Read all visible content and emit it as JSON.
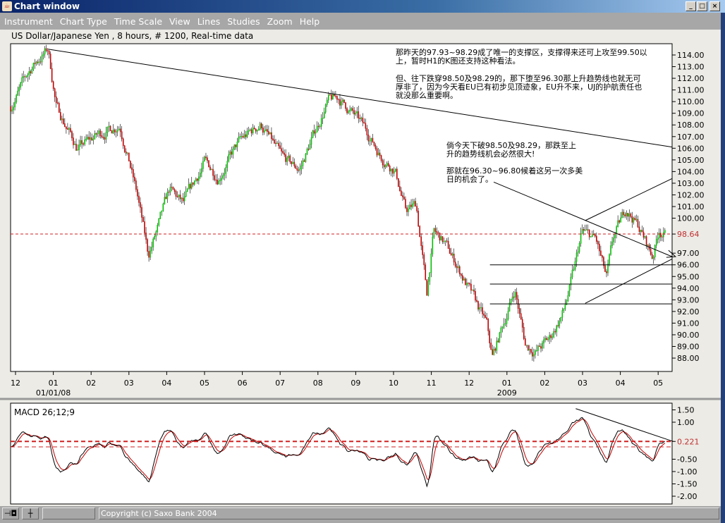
{
  "window": {
    "title": "Chart window",
    "controls": [
      "_",
      "□",
      "×"
    ]
  },
  "menu": [
    "Instrument",
    "Chart Type",
    "Time Scale",
    "View",
    "Lines",
    "Studies",
    "Zoom",
    "Help"
  ],
  "subtitle": "US Dollar/Japanese Yen , 8 hours, # 1200, Real-time data",
  "annotations": {
    "note1": "那昨天的97.93~98.29成了唯一的支撑区，支撑得来还可上攻至99.50以\n上，暂时H1的K图还支持这种看法。",
    "note2": "但、往下跌穿98.50及98.29的，那下堕至96.30那上升趋势线也就无可\n厚非了，因为今天看EU已有初步见顶迹象，EU升不来，UJ的护航责任也\n就没那么重要啊。",
    "note3": "倘今天下破98.50及98.29，那跌至上\n升的趋势线机会必然很大!",
    "note4": "那就在96.30~96.80候着这另一次多美\n日的机会了。"
  },
  "status": {
    "copyright": "Copyright (c) Saxo Bank 2004",
    "icons": [
      "pin-icon",
      "crosshair-icon"
    ]
  },
  "colors": {
    "up": "#00c000",
    "down": "#c00000",
    "ref": "#d02020",
    "text_red": "#c03030"
  },
  "chart_data": [
    {
      "type": "candlestick",
      "title": "US Dollar/Japanese Yen",
      "ylim": [
        87,
        115
      ],
      "yticks": [
        88,
        89,
        90,
        91,
        92,
        93,
        94,
        95,
        96,
        97,
        98.64,
        100,
        101,
        102,
        103,
        104,
        105,
        106,
        107,
        108,
        109,
        110,
        111,
        112,
        113,
        114
      ],
      "xticks": [
        {
          "label": "12",
          "t": 0
        },
        {
          "label": "01",
          "t": 1,
          "sub": "01/01/08"
        },
        {
          "label": "02",
          "t": 2
        },
        {
          "label": "03",
          "t": 3
        },
        {
          "label": "04",
          "t": 4
        },
        {
          "label": "05",
          "t": 5
        },
        {
          "label": "06",
          "t": 6
        },
        {
          "label": "07",
          "t": 7
        },
        {
          "label": "08",
          "t": 8
        },
        {
          "label": "09",
          "t": 9
        },
        {
          "label": "10",
          "t": 10
        },
        {
          "label": "11",
          "t": 11
        },
        {
          "label": "12",
          "t": 12
        },
        {
          "label": "01",
          "t": 13,
          "sub": "2009"
        },
        {
          "label": "02",
          "t": 14
        },
        {
          "label": "03",
          "t": 15
        },
        {
          "label": "04",
          "t": 16
        },
        {
          "label": "05",
          "t": 17
        }
      ],
      "xlim_months": [
        -0.13,
        17.52
      ],
      "last_price": 98.64,
      "path": [
        [
          -0.13,
          109.6
        ],
        [
          0.43,
          113
        ],
        [
          0.86,
          114.5
        ],
        [
          1.08,
          109.6
        ],
        [
          1.64,
          106
        ],
        [
          2.2,
          107.2
        ],
        [
          2.76,
          108.1
        ],
        [
          2.95,
          105.7
        ],
        [
          3.23,
          101.8
        ],
        [
          3.51,
          96.8
        ],
        [
          3.79,
          99.4
        ],
        [
          4.07,
          102.4
        ],
        [
          4.44,
          101.2
        ],
        [
          5.0,
          104.8
        ],
        [
          5.37,
          103.6
        ],
        [
          5.93,
          106.6
        ],
        [
          6.49,
          108.1
        ],
        [
          7.05,
          105.1
        ],
        [
          7.52,
          104.2
        ],
        [
          7.89,
          107.2
        ],
        [
          8.26,
          110
        ],
        [
          8.54,
          110.3
        ],
        [
          8.92,
          109
        ],
        [
          9.29,
          107.5
        ],
        [
          9.66,
          105.4
        ],
        [
          10.04,
          104.2
        ],
        [
          10.32,
          100.6
        ],
        [
          10.6,
          101.2
        ],
        [
          10.88,
          93.5
        ],
        [
          11.06,
          98.8
        ],
        [
          11.34,
          97.9
        ],
        [
          11.72,
          95.7
        ],
        [
          12.09,
          93.3
        ],
        [
          12.46,
          90.9
        ],
        [
          12.61,
          88
        ],
        [
          12.84,
          90.3
        ],
        [
          13.21,
          93.9
        ],
        [
          13.49,
          89.1
        ],
        [
          13.77,
          88.6
        ],
        [
          14.14,
          89.7
        ],
        [
          14.51,
          92.1
        ],
        [
          14.79,
          95.7
        ],
        [
          14.98,
          98.8
        ],
        [
          15.35,
          98.2
        ],
        [
          15.63,
          94.8
        ],
        [
          15.82,
          98.2
        ],
        [
          16.16,
          100.9
        ],
        [
          16.47,
          99.4
        ],
        [
          16.85,
          96.7
        ],
        [
          17.03,
          99.1
        ],
        [
          17.18,
          98.64
        ]
      ],
      "trendlines": [
        {
          "name": "long-term-down",
          "from": [
            0.86,
            114.5
          ],
          "to": [
            17.52,
            106.1
          ]
        },
        {
          "name": "channel-upper",
          "from": [
            15.07,
            99.8
          ],
          "to": [
            17.52,
            103.4
          ]
        },
        {
          "name": "channel-lower",
          "from": [
            15.07,
            92.7
          ],
          "to": [
            17.52,
            96.5
          ]
        },
        {
          "name": "arrow-line",
          "from": [
            12.65,
            103.1
          ],
          "to": [
            17.46,
            96.7
          ]
        }
      ],
      "hlines": [
        {
          "price": 96.0,
          "from": 12.55
        },
        {
          "price": 94.35,
          "from": 12.55
        },
        {
          "price": 92.65,
          "from": 12.55
        }
      ]
    },
    {
      "type": "line",
      "title": "MACD 26;12;9",
      "fast": 12,
      "slow": 26,
      "signal": 9,
      "yticks": [
        1.5,
        1.0,
        0.221,
        -0.5,
        -1.0,
        -1.5,
        -2.0
      ],
      "ylim": [
        -2.3,
        1.75
      ],
      "current": 0.221,
      "trendline": {
        "from": [
          14.82,
          1.55
        ],
        "to": [
          17.4,
          0.22
        ]
      }
    }
  ]
}
